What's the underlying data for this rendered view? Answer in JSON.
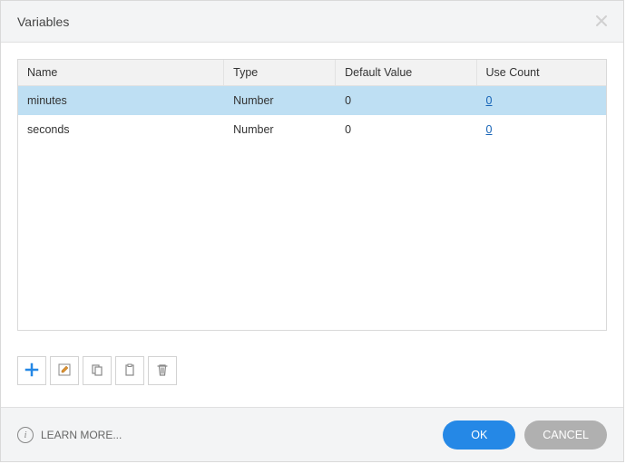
{
  "dialog": {
    "title": "Variables"
  },
  "table": {
    "headers": {
      "name": "Name",
      "type": "Type",
      "default_value": "Default Value",
      "use_count": "Use Count"
    },
    "rows": [
      {
        "name": "minutes",
        "type": "Number",
        "default_value": "0",
        "use_count": "0",
        "selected": true
      },
      {
        "name": "seconds",
        "type": "Number",
        "default_value": "0",
        "use_count": "0",
        "selected": false
      }
    ]
  },
  "footer": {
    "learn_more": "LEARN MORE...",
    "ok": "OK",
    "cancel": "CANCEL"
  }
}
